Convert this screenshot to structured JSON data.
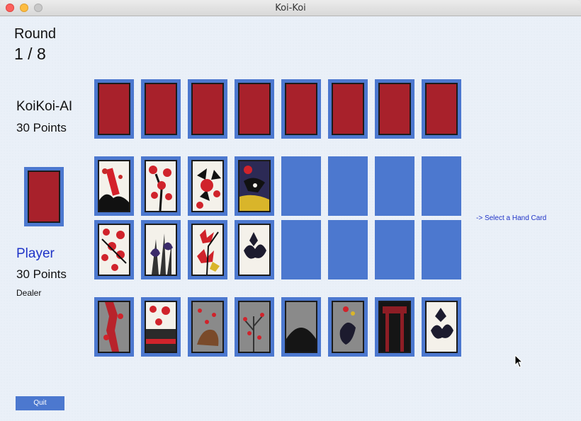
{
  "window": {
    "title": "Koi-Koi"
  },
  "round": {
    "label": "Round",
    "value": "1 / 8"
  },
  "opponent": {
    "name": "KoiKoi-AI",
    "points": "30 Points"
  },
  "player": {
    "name": "Player",
    "points": "30 Points",
    "role": "Dealer"
  },
  "hint": "-> Select a Hand Card",
  "quit_label": "Quit",
  "colors": {
    "slot": "#4c78cf",
    "card_back": "#a8212b",
    "accent_text": "#1f33c7"
  },
  "opponent_hand": {
    "card_count": 8,
    "face": "back"
  },
  "deck": {
    "face": "back"
  },
  "field": {
    "row1": [
      "card",
      "card",
      "card",
      "card",
      "empty",
      "empty",
      "empty",
      "empty"
    ],
    "row2": [
      "card",
      "card",
      "card",
      "card",
      "empty",
      "empty",
      "empty",
      "empty"
    ]
  },
  "player_hand": {
    "card_count": 8,
    "face": "front"
  }
}
